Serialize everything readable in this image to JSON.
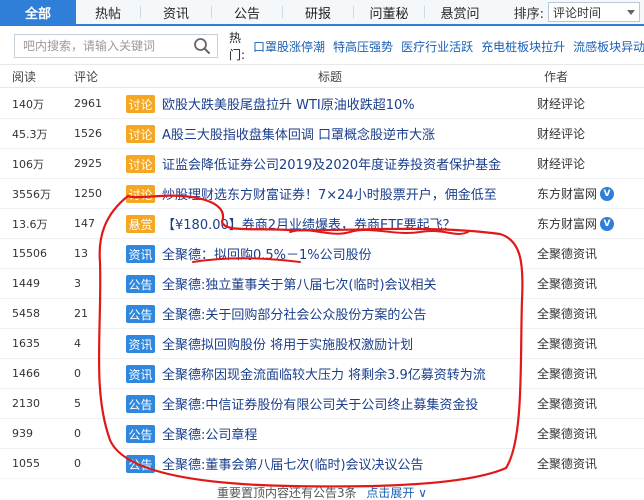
{
  "tabs": [
    {
      "label": "全部",
      "active": true
    },
    {
      "label": "热帖"
    },
    {
      "label": "资讯"
    },
    {
      "label": "公告"
    },
    {
      "label": "研报"
    },
    {
      "label": "问董秘"
    },
    {
      "label": "悬赏问"
    }
  ],
  "sort": {
    "label": "排序:",
    "value": "评论时间"
  },
  "search": {
    "placeholder": "吧内搜索，请输入关键词"
  },
  "hot": {
    "label": "热门:",
    "links": [
      "口罩股涨停潮",
      "特高压强势",
      "医疗行业活跃",
      "充电桩板块拉升",
      "流感板块异动"
    ]
  },
  "columns": {
    "read": "阅读",
    "comment": "评论",
    "title": "标题",
    "author": "作者"
  },
  "rows": [
    {
      "read": "140万",
      "comment": "2961",
      "badge": "讨论",
      "title": "欧股大跌美股尾盘拉升 WTI原油收跌超10%",
      "author": "财经评论"
    },
    {
      "read": "45.3万",
      "comment": "1526",
      "badge": "讨论",
      "title": "A股三大股指收盘集体回调 口罩概念股逆市大涨",
      "author": "财经评论"
    },
    {
      "read": "106万",
      "comment": "2925",
      "badge": "讨论",
      "title": "证监会降低证券公司2019及2020年度证券投资者保护基金",
      "author": "财经评论"
    },
    {
      "read": "3556万",
      "comment": "1250",
      "badge": "讨论",
      "title": "炒股理财选东方财富证券！7×24小时股票开户，佣金低至",
      "author": "东方财富网",
      "verified": true
    },
    {
      "read": "13.6万",
      "comment": "147",
      "badge": "悬赏",
      "title": "【¥180.00】券商2月业绩爆表，券商ETF要起飞？",
      "author": "东方财富网",
      "verified": true
    },
    {
      "read": "15506",
      "comment": "13",
      "badge": "资讯",
      "title": "全聚德：拟回购0.5%－1%公司股份",
      "author": "全聚德资讯"
    },
    {
      "read": "1449",
      "comment": "3",
      "badge": "公告",
      "title": "全聚德:独立董事关于第八届七次(临时)会议相关",
      "author": "全聚德资讯"
    },
    {
      "read": "5458",
      "comment": "21",
      "badge": "公告",
      "title": "全聚德:关于回购部分社会公众股份方案的公告",
      "author": "全聚德资讯"
    },
    {
      "read": "1635",
      "comment": "4",
      "badge": "资讯",
      "title": "全聚德拟回购股份 将用于实施股权激励计划",
      "author": "全聚德资讯"
    },
    {
      "read": "1466",
      "comment": "0",
      "badge": "资讯",
      "title": "全聚德称因现金流面临较大压力 将剩余3.9亿募资转为流",
      "author": "全聚德资讯"
    },
    {
      "read": "2130",
      "comment": "5",
      "badge": "公告",
      "title": "全聚德:中信证券股份有限公司关于公司终止募集资金投",
      "author": "全聚德资讯"
    },
    {
      "read": "939",
      "comment": "0",
      "badge": "公告",
      "title": "全聚德:公司章程",
      "author": "全聚德资讯"
    },
    {
      "read": "1055",
      "comment": "0",
      "badge": "公告",
      "title": "全聚德:董事会第八届七次(临时)会议决议公告",
      "author": "全聚德资讯"
    }
  ],
  "footer": {
    "text": "重要置顶内容还有公告3条",
    "expand": "点击展开"
  },
  "colors": {
    "accent": "#2f7fd9",
    "badge_orange": "#f5a623",
    "badge_blue": "#2f88dd",
    "annotation": "#e01818"
  }
}
